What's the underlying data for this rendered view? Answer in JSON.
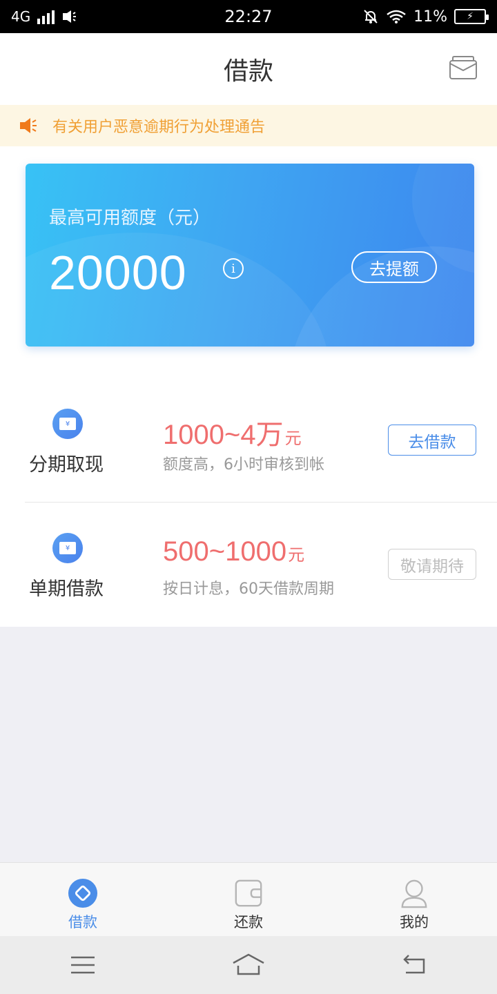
{
  "status_bar": {
    "network": "4G",
    "time": "22:27",
    "battery": "11%"
  },
  "header": {
    "title": "借款",
    "mail_icon": "mail-icon"
  },
  "notice": {
    "icon": "speaker-icon",
    "text": "有关用户恶意逾期行为处理通告",
    "color": "#f0a035"
  },
  "credit_card": {
    "label": "最高可用额度（元）",
    "amount": "20000",
    "info_icon": "i",
    "button_label": "去提额",
    "accent": "#3fa6f2"
  },
  "products": [
    {
      "name": "分期取现",
      "range": "1000~4万",
      "unit": "元",
      "description": "额度高，6小时审核到帐",
      "button_label": "去借款",
      "button_state": "active"
    },
    {
      "name": "单期借款",
      "range": "500~1000",
      "unit": "元",
      "description": "按日计息，60天借款周期",
      "button_label": "敬请期待",
      "button_state": "disabled"
    }
  ],
  "tabbar": {
    "items": [
      {
        "label": "借款",
        "icon": "diamond-icon",
        "active": true
      },
      {
        "label": "还款",
        "icon": "wallet-icon",
        "active": false
      },
      {
        "label": "我的",
        "icon": "user-icon",
        "active": false
      }
    ],
    "active_color": "#4a8de8"
  }
}
